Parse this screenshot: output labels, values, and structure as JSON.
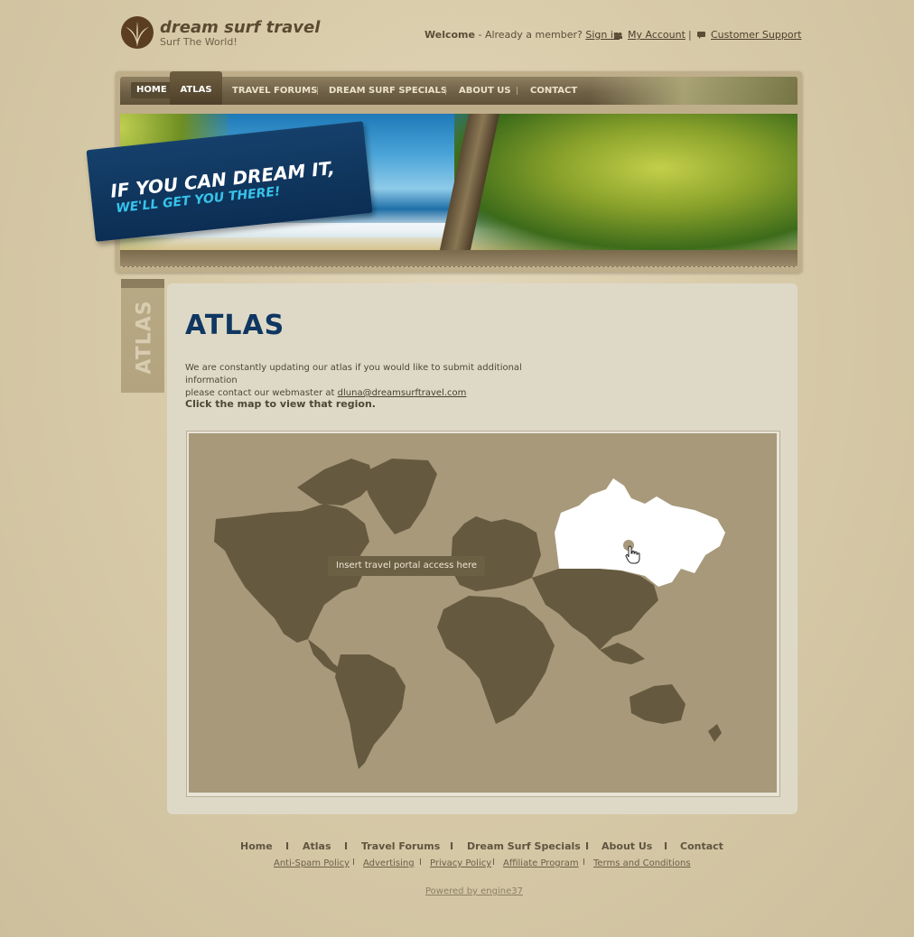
{
  "brand": {
    "name": "dream surf travel",
    "tagline": "Surf The World!"
  },
  "top_links": {
    "welcome": "Welcome",
    "already_member": " - Already a member? ",
    "sign_in": "Sign in",
    "my_account": "My Account",
    "separator": "|",
    "customer_support": "Customer Support"
  },
  "nav": {
    "items": [
      {
        "label": "HOME",
        "active": false
      },
      {
        "label": "ATLAS",
        "active": true
      },
      {
        "label": "TRAVEL FORUMS",
        "active": false
      },
      {
        "label": "DREAM SURF SPECIALS",
        "active": false
      },
      {
        "label": "ABOUT US",
        "active": false
      },
      {
        "label": "CONTACT",
        "active": false
      }
    ]
  },
  "hero": {
    "line1": "IF YOU CAN DREAM IT,",
    "line2": "WE'LL GET YOU THERE!"
  },
  "side_tab": {
    "label": "ATLAS"
  },
  "page": {
    "title": "ATLAS",
    "desc_line1": "We are constantly updating our atlas if you would like to submit additional information",
    "desc_line2": "please contact our webmaster at ",
    "email": "dluna@dreamsurftravel.com",
    "cta": "Click the map to view that region."
  },
  "map": {
    "tooltip": "Insert travel portal access here",
    "highlighted_region": "Russia",
    "land_color": "#655a3f",
    "sea_color": "#a7997a",
    "highlight_color": "#ffffff"
  },
  "footer": {
    "nav": [
      "Home",
      "Atlas",
      "Travel Forums",
      "Dream Surf Specials",
      "About Us",
      "Contact"
    ],
    "nav_separator": "I",
    "links": [
      "Anti-Spam Policy",
      "Advertising",
      "Privacy Policy",
      "Affiliate Program",
      "Terms and Conditions"
    ],
    "link_separator": "I",
    "powered": "Powered by engine37"
  }
}
